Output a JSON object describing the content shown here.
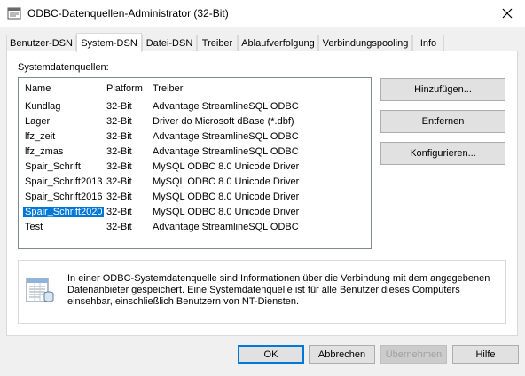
{
  "window": {
    "title": "ODBC-Datenquellen-Administrator (32-Bit)",
    "close_icon": "close-icon"
  },
  "tabs": [
    {
      "label": "Benutzer-DSN",
      "active": false
    },
    {
      "label": "System-DSN",
      "active": true
    },
    {
      "label": "Datei-DSN",
      "active": false
    },
    {
      "label": "Treiber",
      "active": false
    },
    {
      "label": "Ablaufverfolgung",
      "active": false
    },
    {
      "label": "Verbindungspooling",
      "active": false
    },
    {
      "label": "Info",
      "active": false
    }
  ],
  "panel": {
    "list_label": "Systemdatenquellen:",
    "columns": {
      "name": "Name",
      "platform": "Platform",
      "driver": "Treiber"
    },
    "rows": [
      {
        "name": "Kundlag",
        "platform": "32-Bit",
        "driver": "Advantage StreamlineSQL ODBC",
        "selected": false
      },
      {
        "name": "Lager",
        "platform": "32-Bit",
        "driver": "Driver do Microsoft dBase (*.dbf)",
        "selected": false
      },
      {
        "name": "lfz_zeit",
        "platform": "32-Bit",
        "driver": "Advantage StreamlineSQL ODBC",
        "selected": false
      },
      {
        "name": "lfz_zmas",
        "platform": "32-Bit",
        "driver": "Advantage StreamlineSQL ODBC",
        "selected": false
      },
      {
        "name": "Spair_Schrift",
        "platform": "32-Bit",
        "driver": "MySQL ODBC 8.0 Unicode Driver",
        "selected": false
      },
      {
        "name": "Spair_Schrift2013",
        "platform": "32-Bit",
        "driver": "MySQL ODBC 8.0 Unicode Driver",
        "selected": false
      },
      {
        "name": "Spair_Schrift2016",
        "platform": "32-Bit",
        "driver": "MySQL ODBC 8.0 Unicode Driver",
        "selected": false
      },
      {
        "name": "Spair_Schrift2020",
        "platform": "32-Bit",
        "driver": "MySQL ODBC 8.0 Unicode Driver",
        "selected": true
      },
      {
        "name": "Test",
        "platform": "32-Bit",
        "driver": "Advantage StreamlineSQL ODBC",
        "selected": false
      }
    ],
    "buttons": {
      "add": "Hinzufügen...",
      "remove": "Entfernen",
      "configure": "Konfigurieren..."
    },
    "info": {
      "icon": "data-source-icon",
      "text": "In einer ODBC-Systemdatenquelle sind Informationen über die Verbindung mit dem angegebenen Datenanbieter gespeichert. Eine Systemdatenquelle ist für alle Benutzer dieses Computers einsehbar, einschließlich Benutzern von NT-Diensten."
    }
  },
  "footer": {
    "ok": "OK",
    "cancel": "Abbrechen",
    "apply": "Übernehmen",
    "help": "Hilfe"
  },
  "colors": {
    "selection": "#0078d7",
    "default_button_border": "#0078d7"
  }
}
